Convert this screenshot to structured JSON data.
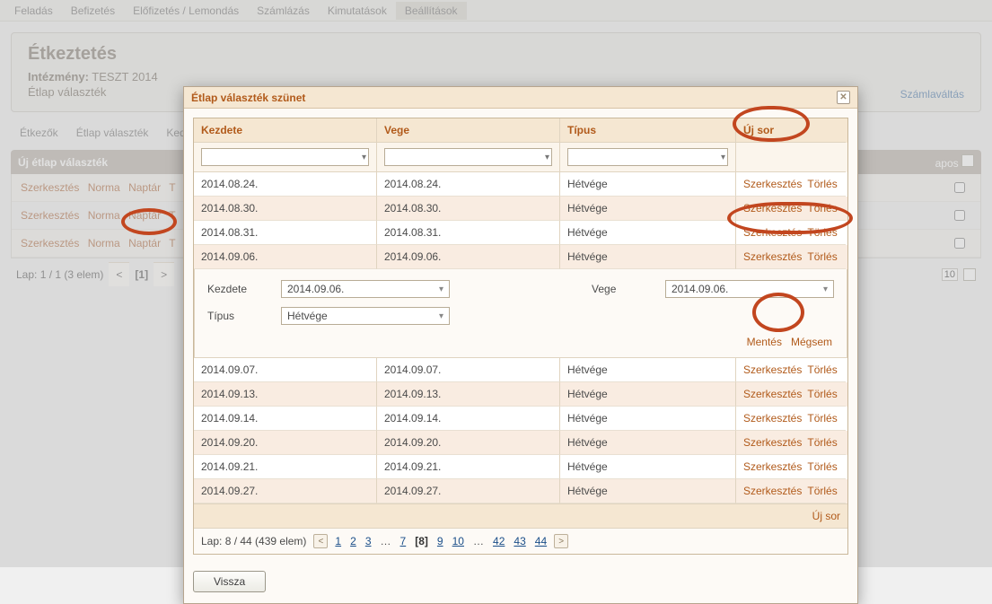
{
  "nav": {
    "items": [
      "Feladás",
      "Befizetés",
      "Előfizetés / Lemondás",
      "Számlázás",
      "Kimutatások",
      "Beállítások"
    ],
    "active_index": 5
  },
  "header": {
    "title": "Étkeztetés",
    "inst_label": "Intézmény:",
    "inst_value": "TESZT 2014",
    "subtitle": "Étlap választék",
    "billing_link": "Számlaváltás"
  },
  "subnav": {
    "items": [
      "Étkezők",
      "Étlap választék",
      "Ked"
    ]
  },
  "bg_grid": {
    "title": "Új étlap választék",
    "right_col": "apos",
    "rows": [
      {
        "actions": [
          "Szerkesztés",
          "Norma",
          "Naptár"
        ],
        "tail": "T"
      },
      {
        "actions": [
          "Szerkesztés",
          "Norma",
          "Naptár"
        ],
        "tail": "T"
      },
      {
        "actions": [
          "Szerkesztés",
          "Norma",
          "Naptár"
        ],
        "tail": "T"
      }
    ],
    "pager": {
      "label": "Lap: 1 / 1 (3 elem)",
      "page": "[1]",
      "sel": "10"
    }
  },
  "dialog": {
    "title": "Étlap választék szünet",
    "headers": {
      "k": "Kezdete",
      "v": "Vege",
      "t": "Típus",
      "a": "Új sor"
    },
    "top_rows": [
      {
        "k": "2014.08.24.",
        "v": "2014.08.24.",
        "t": "Hétvége"
      },
      {
        "k": "2014.08.30.",
        "v": "2014.08.30.",
        "t": "Hétvége"
      },
      {
        "k": "2014.08.31.",
        "v": "2014.08.31.",
        "t": "Hétvége"
      },
      {
        "k": "2014.09.06.",
        "v": "2014.09.06.",
        "t": "Hétvége"
      }
    ],
    "action_edit": "Szerkesztés",
    "action_del": "Törlés",
    "editor": {
      "k_label": "Kezdete",
      "k_value": "2014.09.06.",
      "v_label": "Vege",
      "v_value": "2014.09.06.",
      "t_label": "Típus",
      "t_value": "Hétvége",
      "save": "Mentés",
      "cancel": "Mégsem"
    },
    "bottom_rows": [
      {
        "k": "2014.09.07.",
        "v": "2014.09.07.",
        "t": "Hétvége"
      },
      {
        "k": "2014.09.13.",
        "v": "2014.09.13.",
        "t": "Hétvége"
      },
      {
        "k": "2014.09.14.",
        "v": "2014.09.14.",
        "t": "Hétvége"
      },
      {
        "k": "2014.09.20.",
        "v": "2014.09.20.",
        "t": "Hétvége"
      },
      {
        "k": "2014.09.21.",
        "v": "2014.09.21.",
        "t": "Hétvége"
      },
      {
        "k": "2014.09.27.",
        "v": "2014.09.27.",
        "t": "Hétvége"
      }
    ],
    "new_row_foot": "Új sor",
    "pager": {
      "label": "Lap: 8 / 44 (439 elem)",
      "pages": [
        "1",
        "2",
        "3",
        "…",
        "7",
        "[8]",
        "9",
        "10",
        "…",
        "42",
        "43",
        "44"
      ]
    },
    "back": "Vissza"
  }
}
